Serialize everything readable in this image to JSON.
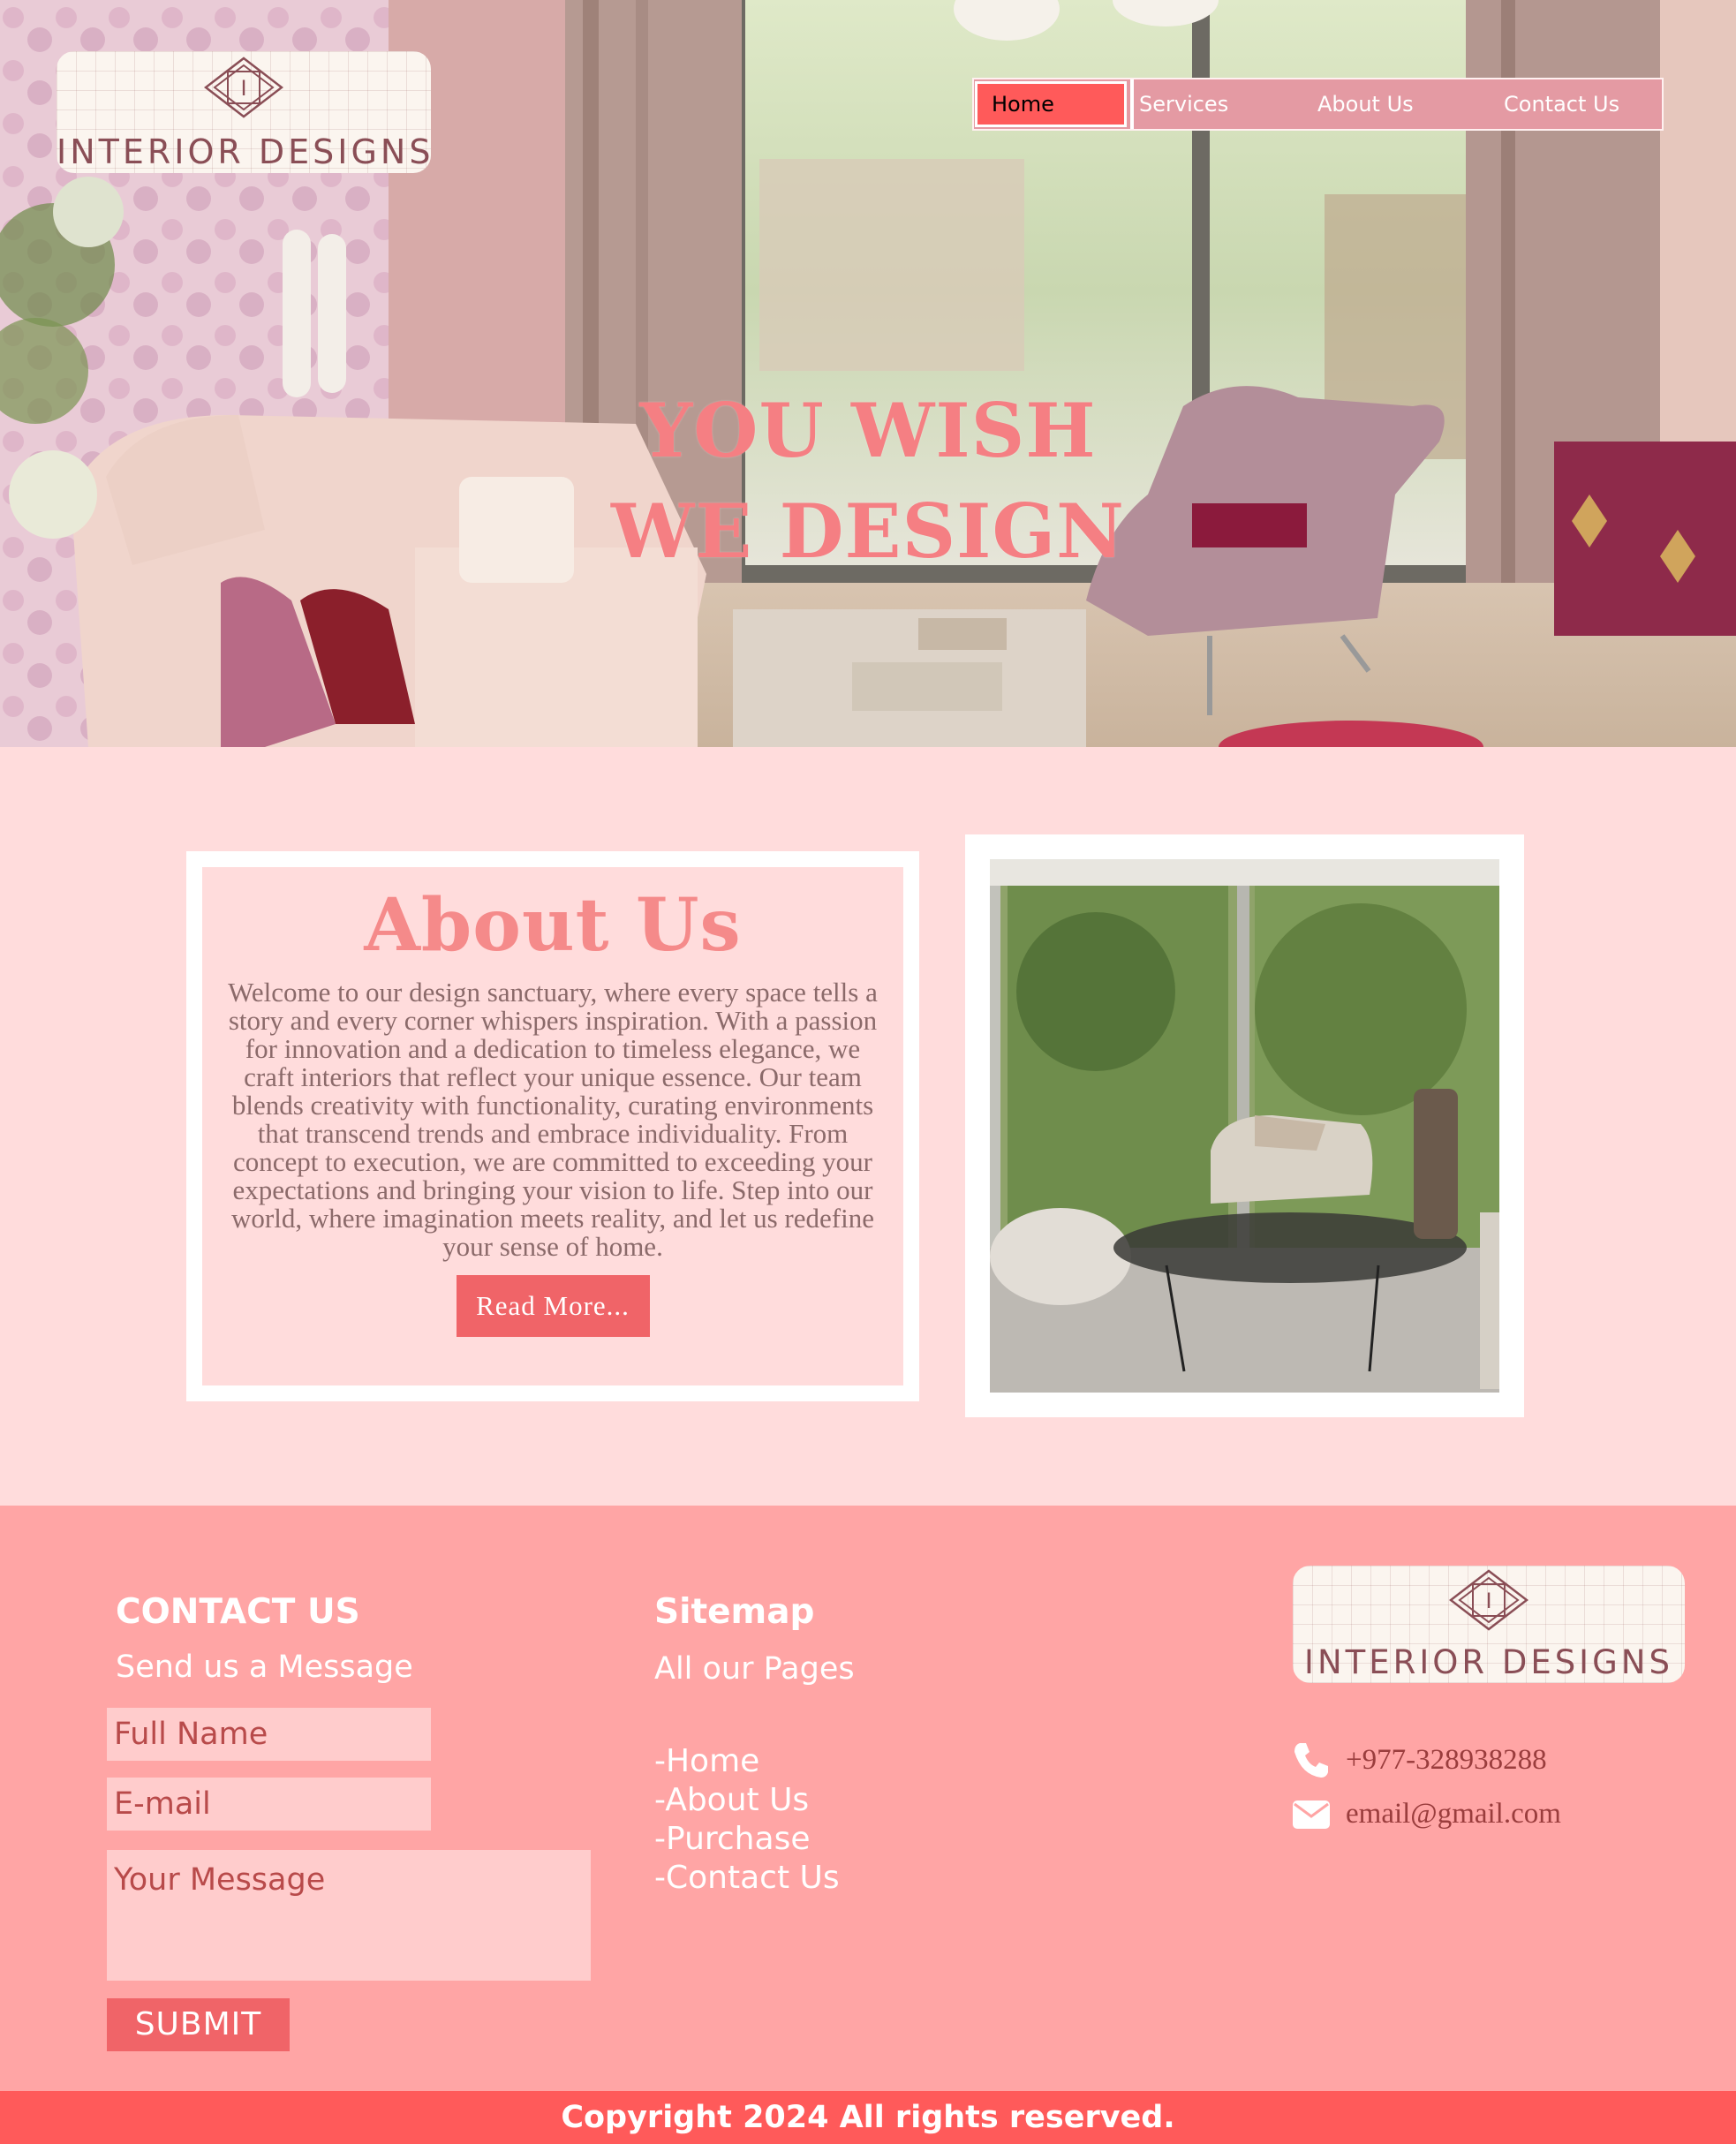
{
  "brand": {
    "logo_initial": "I",
    "logo_text": "INTERIOR DESIGNS"
  },
  "nav": {
    "items": [
      "Home",
      "Services",
      "About Us",
      "Contact Us"
    ],
    "active": "Home"
  },
  "hero": {
    "line1": "YOU WISH",
    "line2": "WE DESIGN"
  },
  "about": {
    "title": "About Us",
    "text": "Welcome to our design sanctuary, where every space tells a story and every corner whispers inspiration. With a passion for innovation and a dedication to timeless elegance, we craft interiors that reflect your unique essence. Our team blends creativity with functionality, curating environments that transcend trends and embrace individuality. From concept to execution, we are committed to exceeding your expectations and bringing your vision to life. Step into our world, where imagination meets reality, and let us redefine your sense of home.",
    "button": "Read More..."
  },
  "footer": {
    "contact": {
      "heading": "CONTACT US",
      "subheading": "Send us a Message",
      "name_placeholder": "Full Name",
      "email_placeholder": "E-mail",
      "message_placeholder": "Your Message",
      "submit": "SUBMIT"
    },
    "sitemap": {
      "heading": "Sitemap",
      "subheading": "All our Pages",
      "links": [
        "-Home",
        "-About Us",
        "-Purchase",
        "-Contact Us"
      ]
    },
    "info": {
      "phone": "+977-328938288",
      "email": "email@gmail.com"
    },
    "copyright": "Copyright 2024 All rights reserved."
  },
  "colors": {
    "accent": "#ff5a5a",
    "nav_bg": "#e49aa3",
    "about_bg": "#ffdcdc",
    "footer_bg": "#ffa5a5",
    "title_pink": "#f58a8a"
  }
}
